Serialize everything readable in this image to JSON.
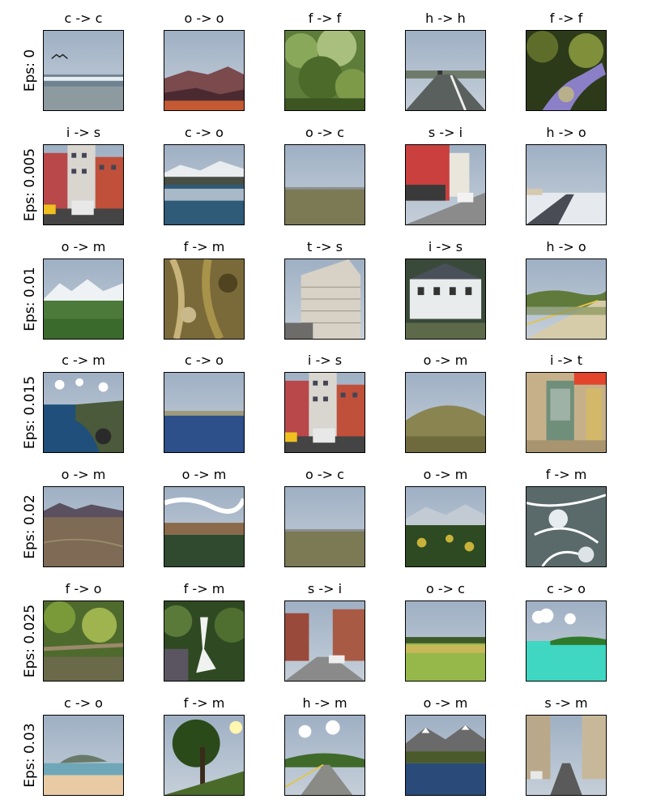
{
  "rows": [
    {
      "label": "Eps: 0",
      "cells": [
        {
          "title": "c -> c",
          "scene": "coast"
        },
        {
          "title": "o -> o",
          "scene": "canyon"
        },
        {
          "title": "f -> f",
          "scene": "forest"
        },
        {
          "title": "h -> h",
          "scene": "highway"
        },
        {
          "title": "f -> f",
          "scene": "forest-stream"
        }
      ]
    },
    {
      "label": "Eps: 0.005",
      "cells": [
        {
          "title": "i -> s",
          "scene": "city-buildings"
        },
        {
          "title": "c -> o",
          "scene": "mountain-lake"
        },
        {
          "title": "o -> c",
          "scene": "field"
        },
        {
          "title": "s -> i",
          "scene": "street"
        },
        {
          "title": "h -> o",
          "scene": "road-snow"
        }
      ]
    },
    {
      "label": "Eps: 0.01",
      "cells": [
        {
          "title": "o -> m",
          "scene": "snow-mountain"
        },
        {
          "title": "f -> m",
          "scene": "rocky-texture"
        },
        {
          "title": "t -> s",
          "scene": "tall-building"
        },
        {
          "title": "i -> s",
          "scene": "houses"
        },
        {
          "title": "h -> o",
          "scene": "road-hills"
        }
      ]
    },
    {
      "label": "Eps: 0.015",
      "cells": [
        {
          "title": "c -> m",
          "scene": "cliff-coast"
        },
        {
          "title": "c -> o",
          "scene": "bay"
        },
        {
          "title": "i -> s",
          "scene": "city-buildings"
        },
        {
          "title": "o -> m",
          "scene": "hill"
        },
        {
          "title": "i -> t",
          "scene": "phone-booth"
        }
      ]
    },
    {
      "label": "Eps: 0.02",
      "cells": [
        {
          "title": "o -> m",
          "scene": "desert"
        },
        {
          "title": "o -> m",
          "scene": "clouds-valley"
        },
        {
          "title": "o -> c",
          "scene": "field"
        },
        {
          "title": "o -> m",
          "scene": "mountain-forest"
        },
        {
          "title": "f -> m",
          "scene": "snow-forest"
        }
      ]
    },
    {
      "label": "Eps: 0.025",
      "cells": [
        {
          "title": "f -> o",
          "scene": "undergrowth"
        },
        {
          "title": "f -> m",
          "scene": "waterfall"
        },
        {
          "title": "s -> i",
          "scene": "street-brick"
        },
        {
          "title": "o -> c",
          "scene": "green-field"
        },
        {
          "title": "c -> o",
          "scene": "tropical"
        }
      ]
    },
    {
      "label": "Eps: 0.03",
      "cells": [
        {
          "title": "c -> o",
          "scene": "beach"
        },
        {
          "title": "f -> m",
          "scene": "tree"
        },
        {
          "title": "h -> m",
          "scene": "road-hills2"
        },
        {
          "title": "o -> m",
          "scene": "mountain-reflection"
        },
        {
          "title": "s -> m",
          "scene": "city-street"
        }
      ]
    }
  ]
}
